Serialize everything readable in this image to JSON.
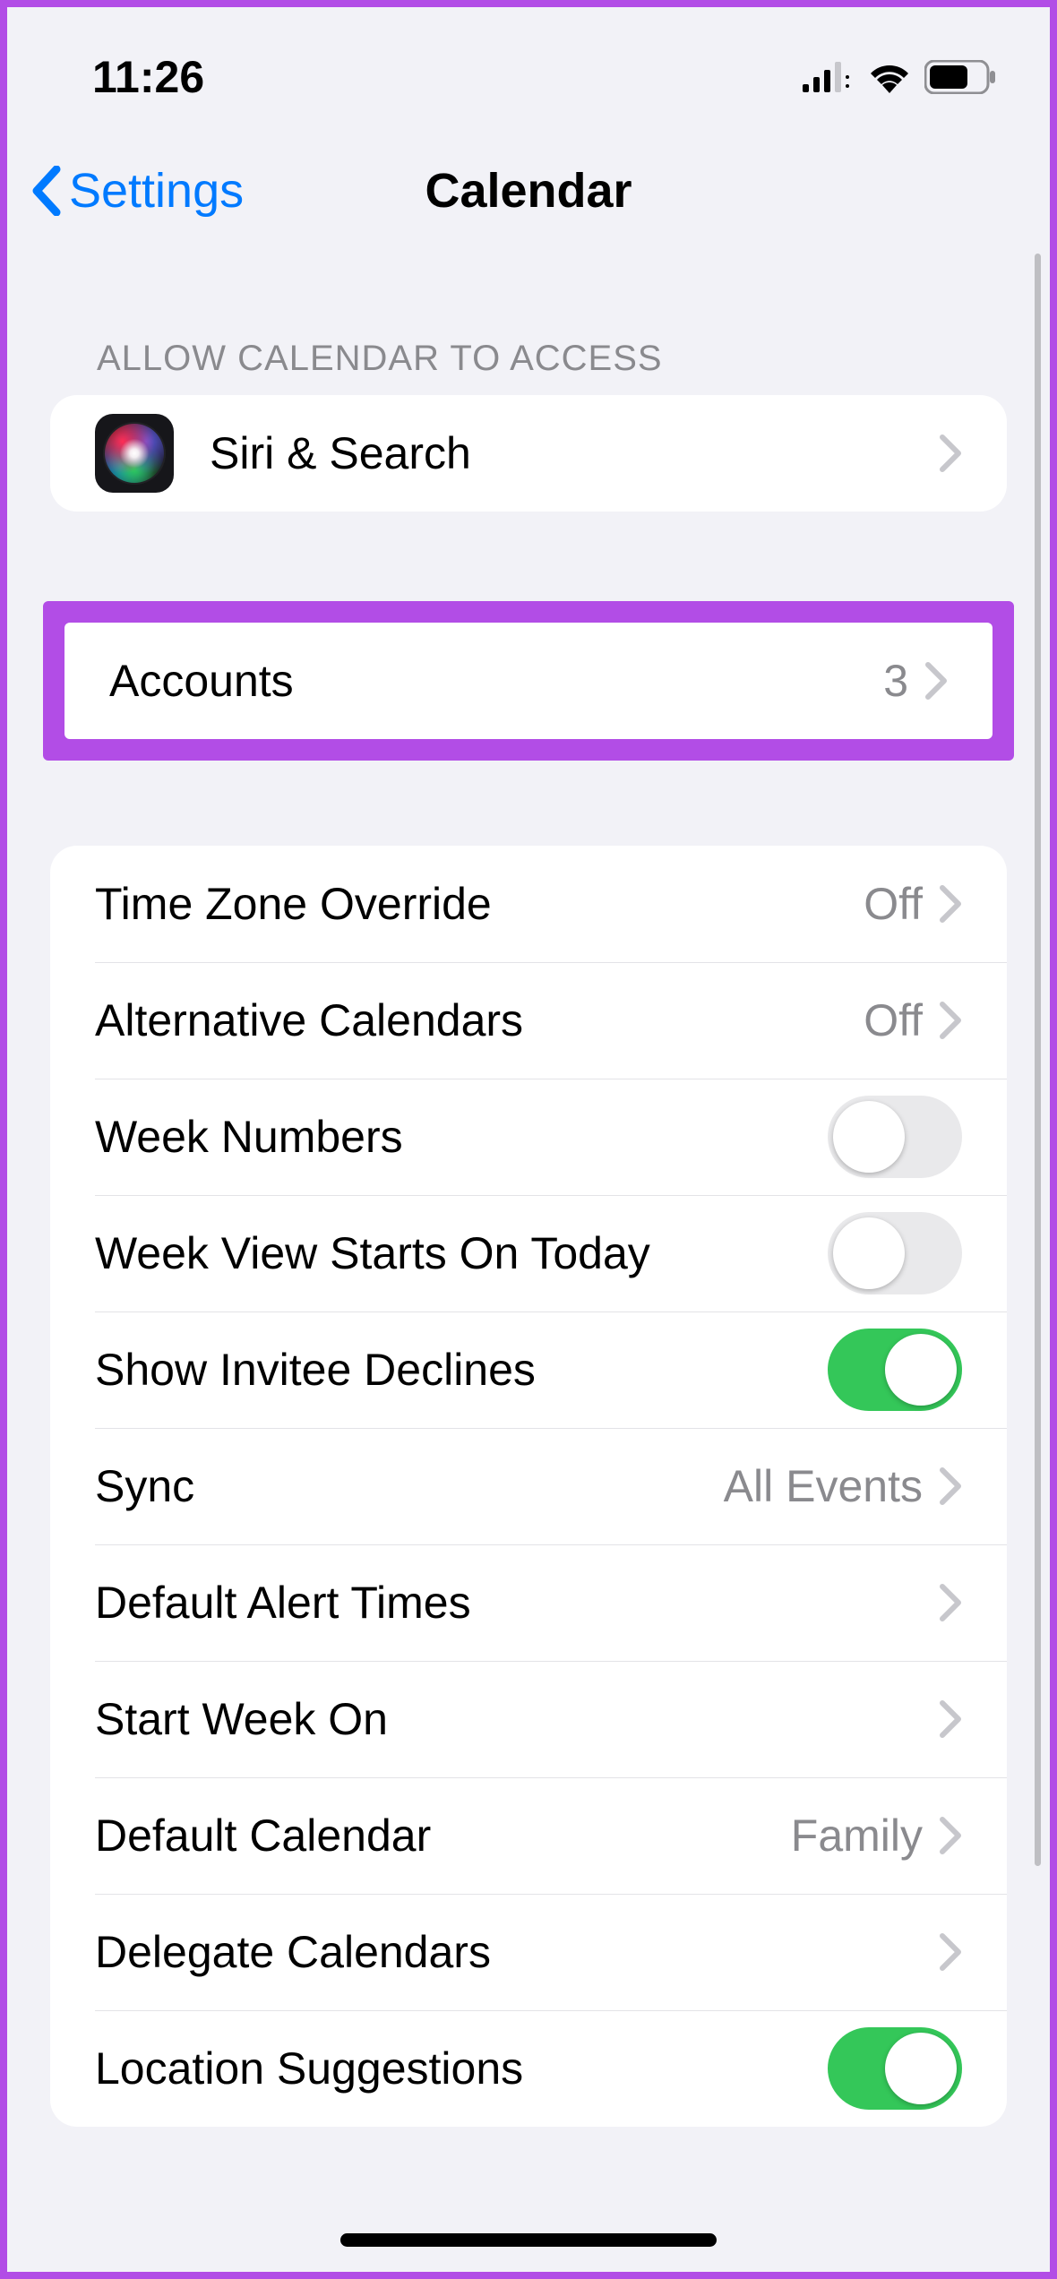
{
  "status": {
    "time": "11:26"
  },
  "nav": {
    "back_label": "Settings",
    "title": "Calendar"
  },
  "groups": {
    "access": {
      "header": "Allow Calendar to Access",
      "siri_label": "Siri & Search"
    },
    "accounts": {
      "label": "Accounts",
      "value": "3"
    },
    "settings": {
      "time_zone_label": "Time Zone Override",
      "time_zone_value": "Off",
      "alt_cal_label": "Alternative Calendars",
      "alt_cal_value": "Off",
      "week_numbers_label": "Week Numbers",
      "week_numbers_on": false,
      "week_view_today_label": "Week View Starts On Today",
      "week_view_today_on": false,
      "show_invitee_label": "Show Invitee Declines",
      "show_invitee_on": true,
      "sync_label": "Sync",
      "sync_value": "All Events",
      "default_alert_label": "Default Alert Times",
      "start_week_label": "Start Week On",
      "default_calendar_label": "Default Calendar",
      "default_calendar_value": "Family",
      "delegate_label": "Delegate Calendars",
      "location_suggest_label": "Location Suggestions",
      "location_suggest_on": true
    }
  }
}
